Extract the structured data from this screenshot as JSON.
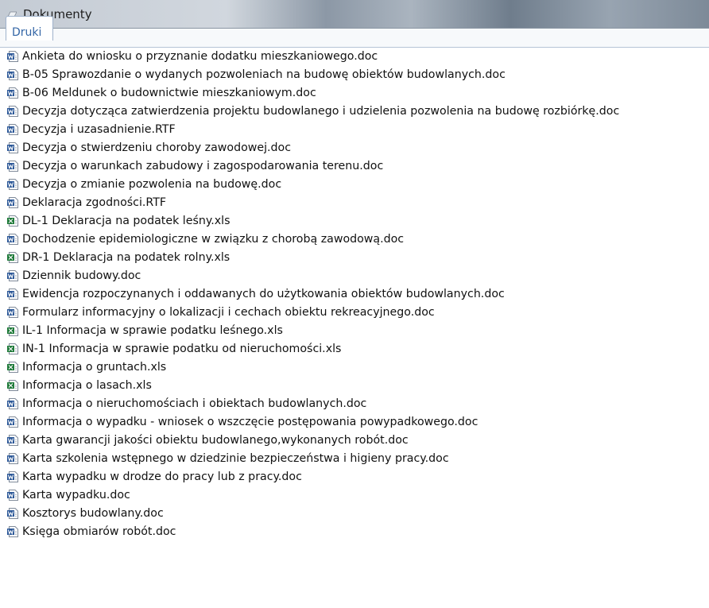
{
  "window": {
    "title": "Dokumenty"
  },
  "tabs": [
    {
      "label": "Druki",
      "active": true
    }
  ],
  "colors": {
    "word_icon": "#2b5797",
    "excel_icon": "#1f7a3a",
    "tab_text": "#3466a6"
  },
  "files": [
    {
      "name": "Ankieta do wniosku o przyznanie dodatku mieszkaniowego.doc",
      "icon": "word-doc-icon"
    },
    {
      "name": "B-05 Sprawozdanie o wydanych pozwoleniach na budowę obiektów budowlanych.doc",
      "icon": "word-doc-icon"
    },
    {
      "name": "B-06 Meldunek o budownictwie mieszkaniowym.doc",
      "icon": "word-doc-icon"
    },
    {
      "name": "Decyzja dotycząca zatwierdzenia projektu budowlanego i udzielenia pozwolenia na budowę rozbiórkę.doc",
      "icon": "word-doc-icon"
    },
    {
      "name": "Decyzja i uzasadnienie.RTF",
      "icon": "word-doc-icon"
    },
    {
      "name": "Decyzja o stwierdzeniu choroby zawodowej.doc",
      "icon": "word-doc-icon"
    },
    {
      "name": "Decyzja o warunkach zabudowy i zagospodarowania terenu.doc",
      "icon": "word-doc-icon"
    },
    {
      "name": "Decyzja o zmianie pozwolenia na budowę.doc",
      "icon": "word-doc-icon"
    },
    {
      "name": "Deklaracja zgodności.RTF",
      "icon": "word-doc-icon"
    },
    {
      "name": "DL-1 Deklaracja na podatek leśny.xls",
      "icon": "excel-sheet-icon"
    },
    {
      "name": "Dochodzenie epidemiologiczne w związku z chorobą zawodową.doc",
      "icon": "word-doc-icon"
    },
    {
      "name": "DR-1 Deklaracja na podatek rolny.xls",
      "icon": "excel-sheet-icon"
    },
    {
      "name": "Dziennik budowy.doc",
      "icon": "word-doc-icon"
    },
    {
      "name": "Ewidencja rozpoczynanych i oddawanych do użytkowania obiektów budowlanych.doc",
      "icon": "word-doc-icon"
    },
    {
      "name": "Formularz informacyjny o lokalizacji i cechach obiektu rekreacyjnego.doc",
      "icon": "word-doc-icon"
    },
    {
      "name": "IL-1 Informacja w sprawie podatku leśnego.xls",
      "icon": "excel-sheet-icon"
    },
    {
      "name": "IN-1 Informacja w sprawie podatku od nieruchomości.xls",
      "icon": "excel-sheet-icon"
    },
    {
      "name": "Informacja o gruntach.xls",
      "icon": "excel-sheet-icon"
    },
    {
      "name": "Informacja o lasach.xls",
      "icon": "excel-sheet-icon"
    },
    {
      "name": "Informacja o nieruchomościach i obiektach budowlanych.doc",
      "icon": "word-doc-icon"
    },
    {
      "name": "Informacja o wypadku - wniosek o wszczęcie postępowania powypadkowego.doc",
      "icon": "word-doc-icon"
    },
    {
      "name": "Karta gwarancji jakości obiektu budowlanego,wykonanych robót.doc",
      "icon": "word-doc-icon"
    },
    {
      "name": "Karta szkolenia wstępnego w dziedzinie bezpieczeństwa i higieny pracy.doc",
      "icon": "word-doc-icon"
    },
    {
      "name": "Karta wypadku w drodze do pracy lub z pracy.doc",
      "icon": "word-doc-icon"
    },
    {
      "name": "Karta wypadku.doc",
      "icon": "word-doc-icon"
    },
    {
      "name": "Kosztorys budowlany.doc",
      "icon": "word-doc-icon"
    },
    {
      "name": "Księga obmiarów robót.doc",
      "icon": "word-doc-icon"
    }
  ]
}
